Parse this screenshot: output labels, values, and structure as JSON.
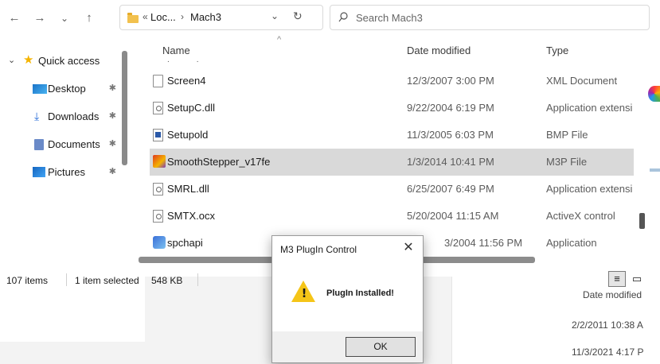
{
  "explorer": {
    "nav": {
      "back": "←",
      "forward": "→",
      "recent": "⌄",
      "up": "↑"
    },
    "address": {
      "prefix": "«",
      "crumb1": "Loc...",
      "sep": "›",
      "crumb2": "Mach3",
      "dropdown": "⌄",
      "refresh": "↻"
    },
    "search": {
      "placeholder": "Search Mach3",
      "icon": "search-icon"
    },
    "sidebar": {
      "items": [
        {
          "label": "Quick access",
          "icon": "star-icon",
          "color": "#f5b400"
        },
        {
          "label": "Desktop",
          "icon": "desktop-icon",
          "color": "#2b8fd8"
        },
        {
          "label": "Downloads",
          "icon": "download-icon",
          "color": "#2b6fd8"
        },
        {
          "label": "Documents",
          "icon": "documents-icon",
          "color": "#6a8ac8"
        },
        {
          "label": "Pictures",
          "icon": "pictures-icon",
          "color": "#2b7fd8"
        }
      ],
      "pin_glyph": "📌"
    },
    "columns": {
      "name": "Name",
      "date": "Date modified",
      "type": "Type",
      "sort_glyph": "^"
    },
    "rows": [
      {
        "name": "Screen4",
        "date": "12/3/2007 3:00 PM",
        "type": "XML Document",
        "icon": "document-icon"
      },
      {
        "name": "SetupC.dll",
        "date": "9/22/2004 6:19 PM",
        "type": "Application extensi",
        "icon": "dll-icon"
      },
      {
        "name": "Setupold",
        "date": "11/3/2005 6:03 PM",
        "type": "BMP File",
        "icon": "bmp-icon"
      },
      {
        "name": "SmoothStepper_v17fe",
        "date": "1/3/2014 10:41 PM",
        "type": "M3P File",
        "icon": "m3p-icon",
        "selected": true
      },
      {
        "name": "SMRL.dll",
        "date": "6/25/2007 6:49 PM",
        "type": "Application extensi",
        "icon": "dll-icon"
      },
      {
        "name": "SMTX.ocx",
        "date": "5/20/2004 11:15 AM",
        "type": "ActiveX control",
        "icon": "ocx-icon"
      },
      {
        "name": "spchapi",
        "date": "3/2004 11:56 PM",
        "type": "Application",
        "icon": "app-icon"
      }
    ],
    "status": {
      "count": "107 items",
      "selection": "1 item selected",
      "size": "548 KB"
    }
  },
  "background": {
    "date_header": "Date modified",
    "dates": [
      "2/2/2011 10:38 A",
      "11/3/2021 4:17 P"
    ]
  },
  "dialog": {
    "title": "M3 PlugIn Control",
    "close": "✕",
    "message": "PlugIn Installed!",
    "ok_label": "OK",
    "icon": "warning-icon"
  }
}
